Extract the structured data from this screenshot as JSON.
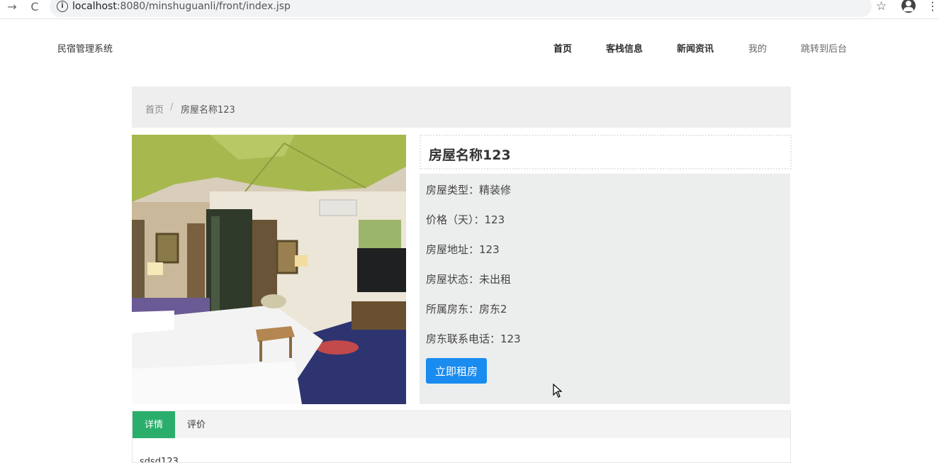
{
  "browser": {
    "url_host": "localhost",
    "url_path": ":8080/minshuguanli/front/index.jsp"
  },
  "site": {
    "title": "民宿管理系统",
    "nav": [
      "首页",
      "客栈信息",
      "新闻资讯",
      "我的",
      "跳转到后台"
    ]
  },
  "breadcrumb": {
    "home": "首页",
    "separator": "/",
    "current": "房屋名称123"
  },
  "room": {
    "name": "房屋名称123",
    "fields": [
      "房屋类型：精装修",
      "价格（天）：123",
      "房屋地址：123",
      "房屋状态：未出租",
      "所属房东：房东2",
      "房东联系电话：123"
    ],
    "rent_button": "立即租房"
  },
  "tabs": {
    "items": [
      "详情",
      "评价"
    ],
    "content": "sdsd123"
  },
  "colors": {
    "accent_blue": "#1a8cf0",
    "tab_green": "#2bae6c"
  }
}
